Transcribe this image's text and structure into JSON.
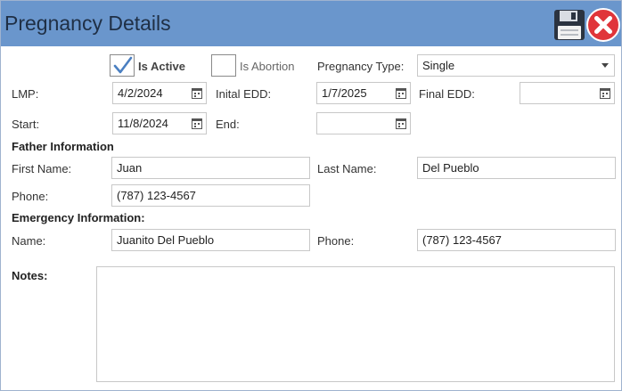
{
  "window": {
    "title": "Pregnancy Details",
    "save_icon": "floppy-disk-icon",
    "close_icon": "red-x-close-icon"
  },
  "flags": {
    "is_active_label": "Is Active",
    "is_active_checked": true,
    "is_abortion_label": "Is Abortion",
    "is_abortion_checked": false,
    "pregnancy_type_label": "Pregnancy Type:",
    "pregnancy_type_value": "Single"
  },
  "dates": {
    "lmp_label": "LMP:",
    "lmp_value": "4/2/2024",
    "initial_edd_label": "Inital EDD:",
    "initial_edd_value": "1/7/2025",
    "final_edd_label": "Final EDD:",
    "final_edd_value": "",
    "start_label": "Start:",
    "start_value": "11/8/2024",
    "end_label": "End:",
    "end_value": ""
  },
  "father": {
    "heading": "Father Information",
    "first_name_label": "First Name:",
    "first_name_value": "Juan",
    "last_name_label": "Last Name:",
    "last_name_value": "Del Pueblo",
    "phone_label": "Phone:",
    "phone_value": "(787) 123-4567"
  },
  "emergency": {
    "heading": "Emergency Information:",
    "name_label": "Name:",
    "name_value": "Juanito Del Pueblo",
    "phone_label": "Phone:",
    "phone_value": "(787) 123-4567"
  },
  "notes": {
    "label": "Notes:",
    "value": ""
  },
  "colors": {
    "titlebar": "#6a96cc",
    "close_red": "#e0353a",
    "check_blue": "#4a7fc1"
  }
}
